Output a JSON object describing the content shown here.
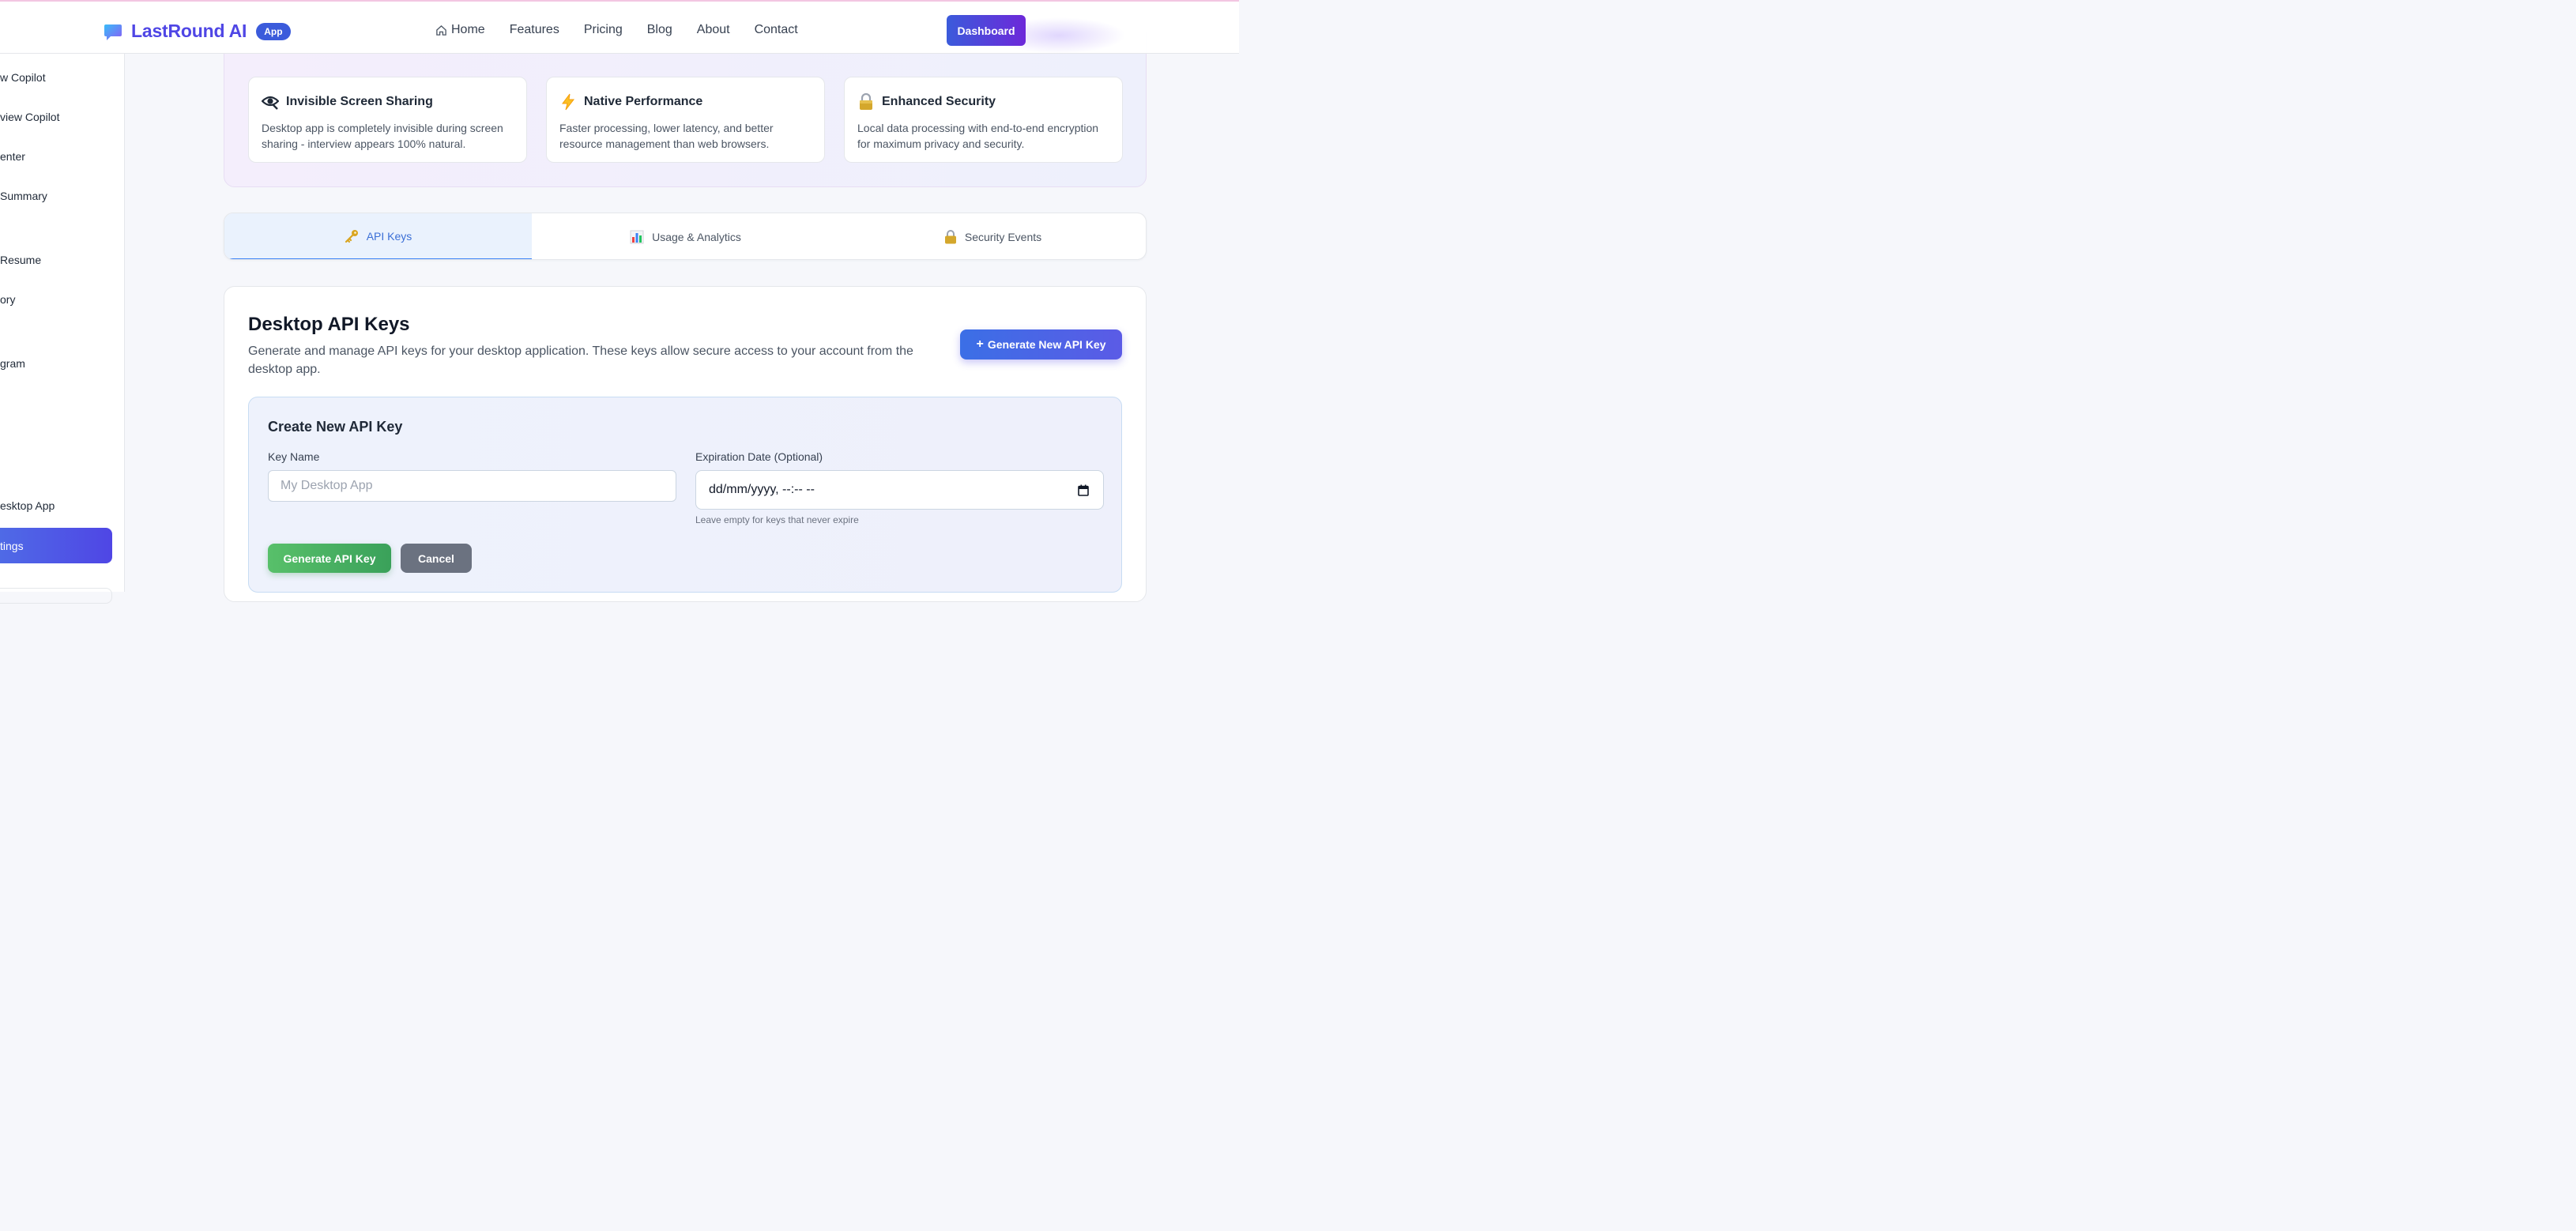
{
  "header": {
    "brand_name": "LastRound AI",
    "brand_badge": "App",
    "nav": [
      "Home",
      "Features",
      "Pricing",
      "Blog",
      "About",
      "Contact"
    ],
    "dashboard_label": "Dashboard"
  },
  "sidebar": {
    "items": [
      {
        "label": "w Copilot"
      },
      {
        "label": "view Copilot"
      },
      {
        "label": "enter"
      },
      {
        "label": "Summary"
      },
      {
        "label": " Resume"
      },
      {
        "label": "ory"
      },
      {
        "label": "gram"
      },
      {
        "label": "esktop App"
      }
    ],
    "active_label": "tings"
  },
  "features": [
    {
      "icon": "eye-icon",
      "title": "Invisible Screen Sharing",
      "desc": "Desktop app is completely invisible during screen sharing - interview appears 100% natural."
    },
    {
      "icon": "lightning-icon",
      "title": "Native Performance",
      "desc": "Faster processing, lower latency, and better resource management than web browsers."
    },
    {
      "icon": "lock-icon",
      "title": "Enhanced Security",
      "desc": "Local data processing with end-to-end encryption for maximum privacy and security."
    }
  ],
  "tabs": [
    {
      "icon": "key-icon",
      "label": "API Keys",
      "active": true
    },
    {
      "icon": "chart-icon",
      "label": "Usage & Analytics",
      "active": false
    },
    {
      "icon": "lock-icon",
      "label": "Security Events",
      "active": false
    }
  ],
  "main": {
    "title": "Desktop API Keys",
    "description": "Generate and manage API keys for your desktop application. These keys allow secure access to your account from the desktop app.",
    "generate_label": "Generate New API Key",
    "create": {
      "title": "Create New API Key",
      "key_name_label": "Key Name",
      "key_name_placeholder": "My Desktop App",
      "expiration_label": "Expiration Date (Optional)",
      "expiration_value": "dd/mm/yyyy, --:-- --",
      "hint": "Leave empty for keys that never expire",
      "submit_label": "Generate API Key",
      "cancel_label": "Cancel"
    }
  },
  "colors": {
    "brand": "#4f46e5",
    "accent_blue": "#3b5bdb",
    "success": "#3aa15a",
    "neutral_button": "#6b7280"
  }
}
